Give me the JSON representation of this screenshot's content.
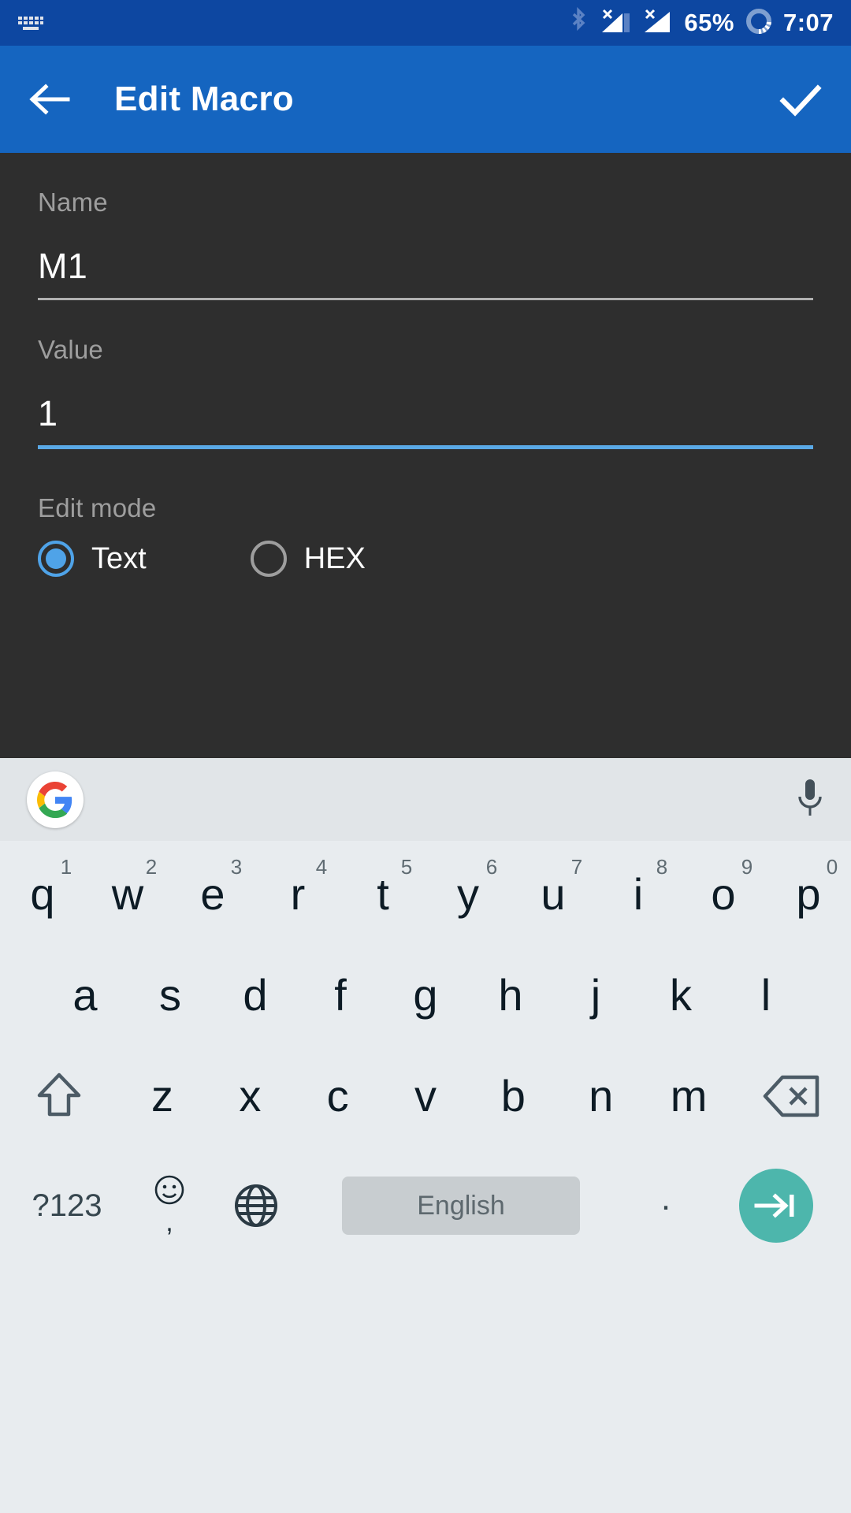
{
  "status_bar": {
    "keyboard_icon": "keyboard-icon",
    "bluetooth_icon": "bluetooth-icon",
    "signal_1_icon": "signal-no-sim-icon",
    "signal_2_icon": "signal-no-sim-icon",
    "battery_percent": "65%",
    "battery_icon": "battery-circle-icon",
    "time": "7:07",
    "background_color": "#0d47a1"
  },
  "app_bar": {
    "back_icon": "arrow-back-icon",
    "title": "Edit Macro",
    "confirm_icon": "check-icon",
    "background_color": "#1565c0"
  },
  "form": {
    "name_field": {
      "label": "Name",
      "value": "M1",
      "focused": false,
      "underline_color": "#b0b0b0"
    },
    "value_field": {
      "label": "Value",
      "value": "1",
      "focused": true,
      "underline_color": "#5aa9e6"
    },
    "edit_mode": {
      "label": "Edit mode",
      "options": [
        {
          "label": "Text",
          "selected": true
        },
        {
          "label": "HEX",
          "selected": false
        }
      ],
      "selected_color": "#4fa3e8",
      "unselected_color": "#9e9e9e"
    },
    "background_color": "#2e2e2e"
  },
  "keyboard": {
    "toolbar": {
      "google_logo": "google-g-icon",
      "mic_icon": "microphone-icon"
    },
    "row1": [
      {
        "char": "q",
        "num": "1"
      },
      {
        "char": "w",
        "num": "2"
      },
      {
        "char": "e",
        "num": "3"
      },
      {
        "char": "r",
        "num": "4"
      },
      {
        "char": "t",
        "num": "5"
      },
      {
        "char": "y",
        "num": "6"
      },
      {
        "char": "u",
        "num": "7"
      },
      {
        "char": "i",
        "num": "8"
      },
      {
        "char": "o",
        "num": "9"
      },
      {
        "char": "p",
        "num": "0"
      }
    ],
    "row2": [
      {
        "char": "a"
      },
      {
        "char": "s"
      },
      {
        "char": "d"
      },
      {
        "char": "f"
      },
      {
        "char": "g"
      },
      {
        "char": "h"
      },
      {
        "char": "j"
      },
      {
        "char": "k"
      },
      {
        "char": "l"
      }
    ],
    "row3": {
      "shift_icon": "shift-icon",
      "keys": [
        {
          "char": "z"
        },
        {
          "char": "x"
        },
        {
          "char": "c"
        },
        {
          "char": "v"
        },
        {
          "char": "b"
        },
        {
          "char": "n"
        },
        {
          "char": "m"
        }
      ],
      "backspace_icon": "backspace-icon"
    },
    "row4": {
      "symbols_label": "?123",
      "emoji_icon": "emoji-icon",
      "comma_label": ",",
      "globe_icon": "globe-icon",
      "space_label": "English",
      "period_label": ".",
      "enter_icon": "tab-next-icon",
      "enter_color": "#4db6ac"
    },
    "background_color": "#e8ecef"
  }
}
